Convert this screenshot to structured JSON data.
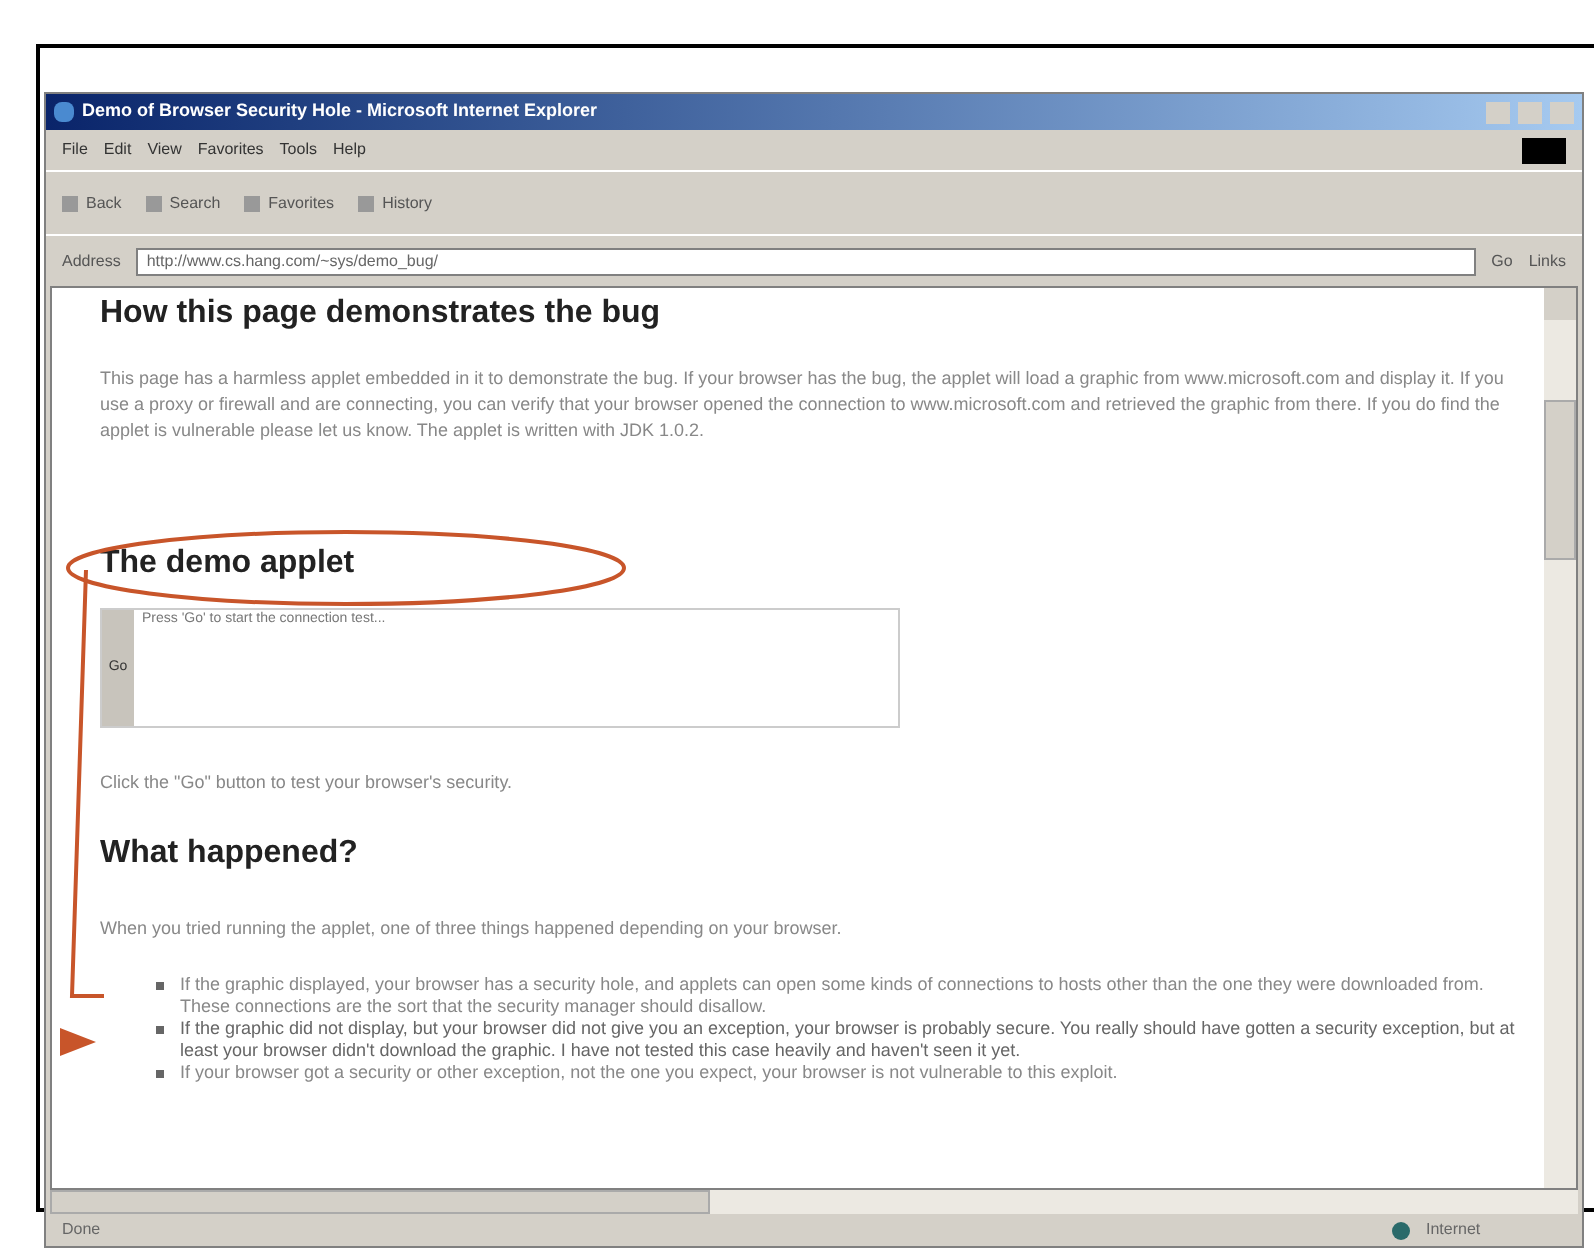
{
  "window": {
    "title": "Demo of Browser Security Hole - Microsoft Internet Explorer"
  },
  "menu": [
    "File",
    "Edit",
    "View",
    "Favorites",
    "Tools",
    "Help"
  ],
  "toolbar": [
    "Back",
    "Search",
    "Favorites",
    "History"
  ],
  "address": {
    "label": "Address",
    "value": "http://www.cs.hang.com/~sys/demo_bug/",
    "go": "Go",
    "links": "Links"
  },
  "page": {
    "heading_1": "How this page demonstrates the bug",
    "paragraph_1": "This page has a harmless applet embedded in it to demonstrate the bug. If your browser has the bug, the applet will load a graphic from www.microsoft.com and display it. If you use a proxy or firewall and are connecting, you can verify that your browser opened the connection to www.microsoft.com and retrieved the graphic from there. If you do find the applet is vulnerable please let us know. The applet is written with JDK 1.0.2.",
    "heading_2": "The demo applet",
    "applet": {
      "button": "Go",
      "output": "Press 'Go' to start the connection test..."
    },
    "hint": "Click the \"Go\" button to test your browser's security.",
    "heading_3": "What happened?",
    "paragraph_2": "When you tried running the applet, one of three things happened depending on your browser.",
    "bullets": [
      {
        "text": "If the graphic displayed, your browser has a security hole, and applets can open some kinds of connections to hosts other than the one they were downloaded from. These connections are the sort that the security manager should disallow.",
        "highlighted": false
      },
      {
        "text": "If the graphic did not display, but your browser did not give you an exception, your browser is probably secure. You really should have gotten a security exception, but at least your browser didn't download the graphic. I have not tested this case heavily and haven't seen it yet.",
        "highlighted": true
      },
      {
        "text": "If your browser got a security or other exception, not the one you expect, your browser is not vulnerable to this exploit.",
        "highlighted": false
      }
    ]
  },
  "status_bar": {
    "text": "Done",
    "zone": "Internet"
  }
}
